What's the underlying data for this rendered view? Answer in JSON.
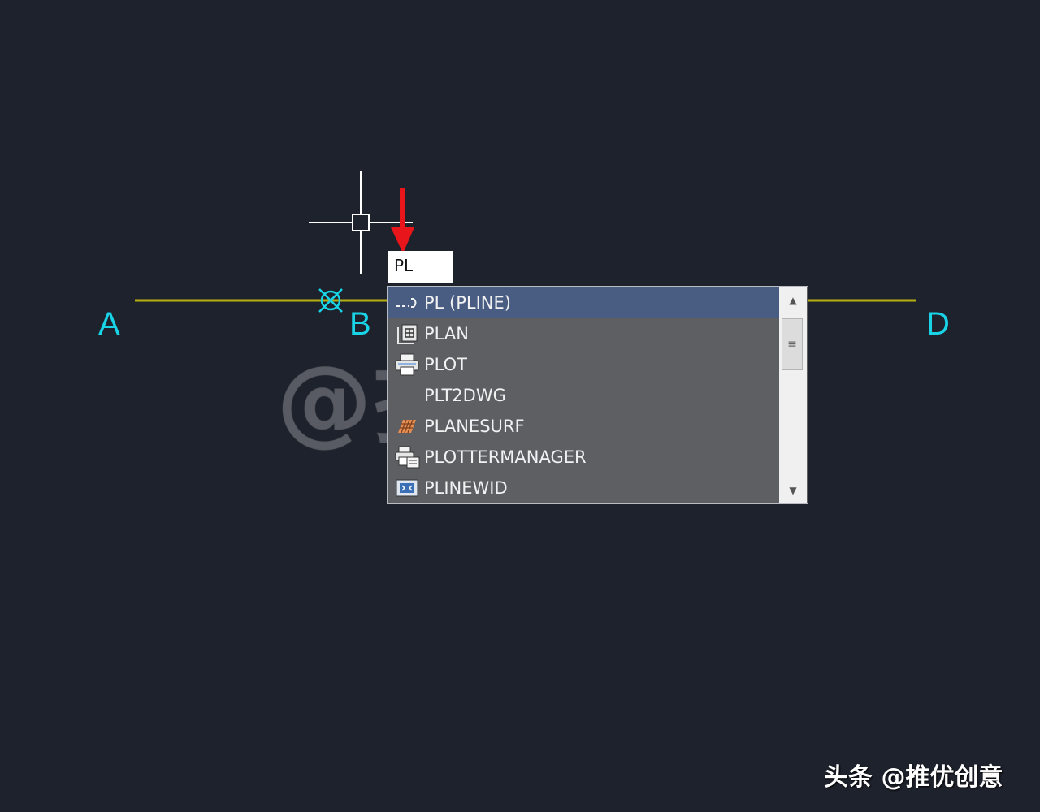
{
  "drawing": {
    "points": [
      "A",
      "B",
      "D"
    ],
    "line_color": "#b8ad12",
    "label_color": "#19d3e6",
    "snap_marker_color": "#19d3e6",
    "crosshair_color": "#ffffff",
    "arrow_color": "#e8161a"
  },
  "watermark": "@推优创意",
  "command_input": {
    "value": "PL"
  },
  "autocomplete": {
    "items": [
      {
        "label": "PL (PLINE)",
        "icon": "polyline-icon",
        "selected": true
      },
      {
        "label": "PLAN",
        "icon": "plan-icon"
      },
      {
        "label": "PLOT",
        "icon": "printer-icon"
      },
      {
        "label": "PLT2DWG",
        "icon": ""
      },
      {
        "label": "PLANESURF",
        "icon": "planesurf-icon"
      },
      {
        "label": "PLOTTERMANAGER",
        "icon": "plotter-manager-icon"
      },
      {
        "label": "PLINEWID",
        "icon": "plinewid-icon"
      }
    ]
  },
  "credit": "头条 @推优创意"
}
